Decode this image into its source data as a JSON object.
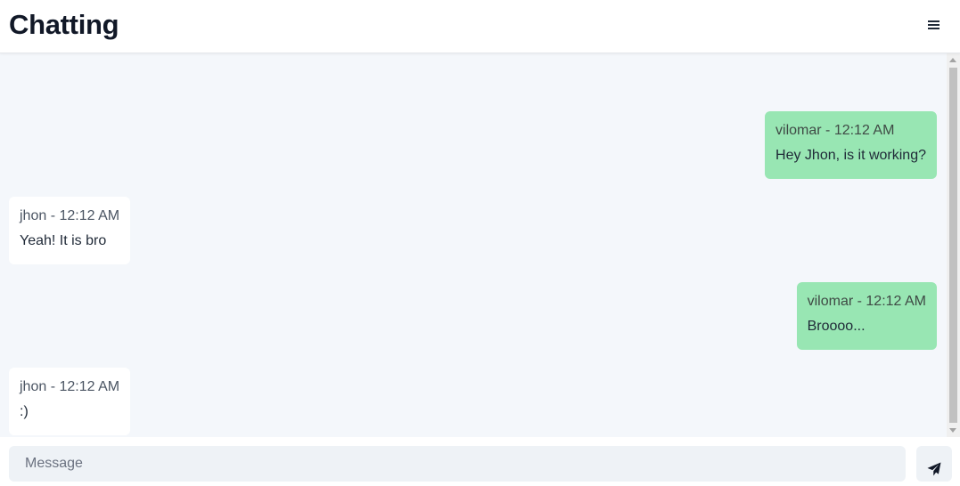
{
  "header": {
    "title": "Chatting",
    "menu_icon": "hamburger-menu-icon"
  },
  "messages": [
    {
      "direction": "outgoing",
      "meta": "vilomar - 12:12 AM",
      "text": "Hey Jhon, is it working?",
      "color": "#98e6b3"
    },
    {
      "direction": "incoming",
      "meta": "jhon - 12:12 AM",
      "text": "Yeah! It is bro",
      "color": "#ffffff"
    },
    {
      "direction": "outgoing",
      "meta": "vilomar - 12:12 AM",
      "text": "Broooo...",
      "color": "#98e6b3"
    },
    {
      "direction": "incoming",
      "meta": "jhon - 12:12 AM",
      "text": ":)",
      "color": "#ffffff"
    }
  ],
  "composer": {
    "placeholder": "Message",
    "value": "",
    "send_icon": "paper-plane-icon"
  },
  "colors": {
    "chat_background": "#f4f7fb",
    "outgoing_bubble": "#98e6b3",
    "incoming_bubble": "#ffffff",
    "input_background": "#eef2f6"
  }
}
